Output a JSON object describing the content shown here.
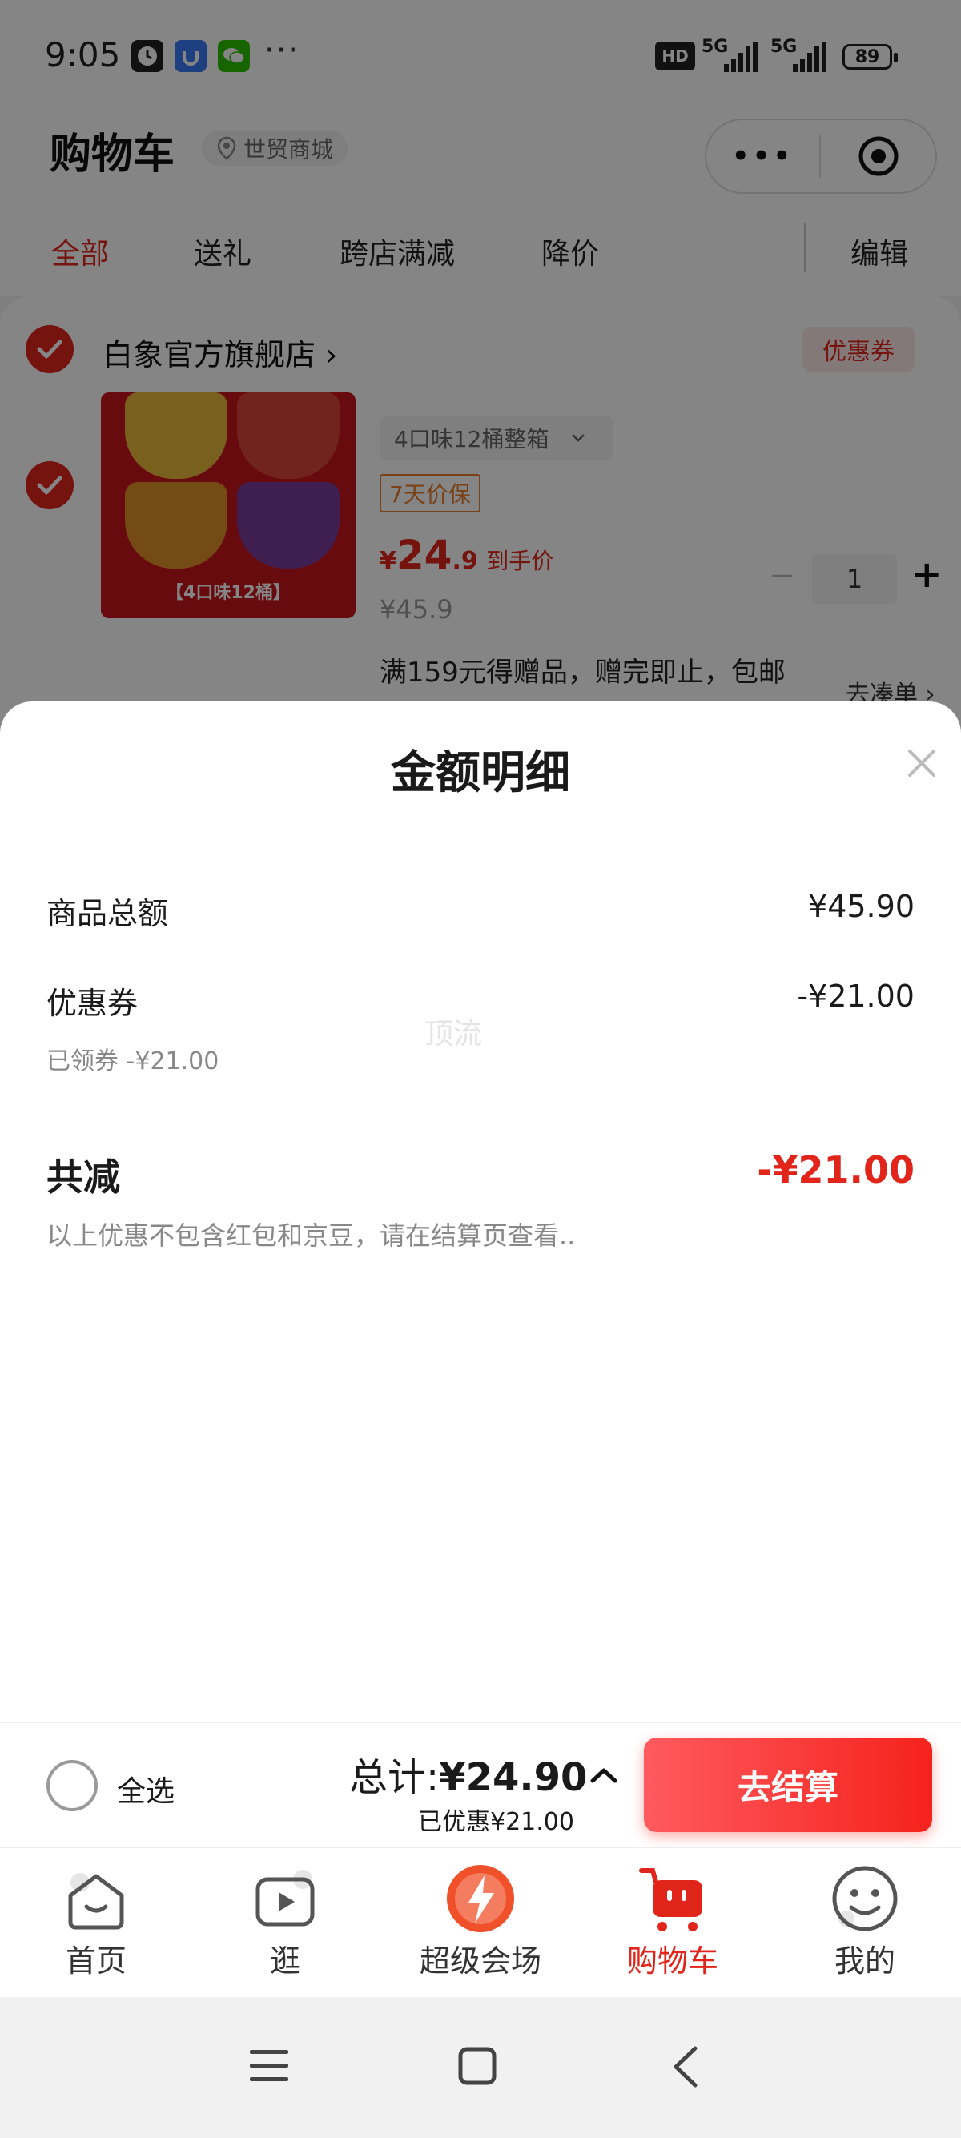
{
  "status_bar": {
    "time": "9:05",
    "dots": "···",
    "signal_1": "5G",
    "signal_2": "5G",
    "hd_label": "HD",
    "battery": "89"
  },
  "header": {
    "title": "购物车",
    "location": "世贸商城",
    "tabs": [
      {
        "label": "全部",
        "active": true
      },
      {
        "label": "送礼"
      },
      {
        "label": "跨店满减"
      },
      {
        "label": "降价"
      }
    ],
    "edit_label": "编辑"
  },
  "cart": {
    "store_name": "白象官方旗舰店",
    "store_arrow": "›",
    "coupon_label": "优惠券",
    "product": {
      "image_label": "【4口味12桶】",
      "variant": "4口味12桶整箱",
      "guarantee": "7天价保",
      "currency": "¥",
      "price_int": "24",
      "price_dec": ".9",
      "price_note": "到手价",
      "original_price": "¥45.9",
      "quantity": "1",
      "minus": "−",
      "plus": "+",
      "promo": "满159元得赠品，赠完即止，包邮",
      "promo_link": "去凑单 ›"
    }
  },
  "sheet": {
    "title": "金额明细",
    "rows": [
      {
        "label": "商品总额",
        "value": "¥45.90"
      },
      {
        "label": "优惠券",
        "value": "-¥21.00",
        "sub": "已领券 -¥21.00"
      }
    ],
    "watermark": "顶流",
    "total_label": "共减",
    "total_value": "-¥21.00",
    "note": "以上优惠不包含红包和京豆，请在结算页查看.."
  },
  "checkout": {
    "select_all": "全选",
    "total_prefix": "总计:",
    "total_amount": "¥24.90",
    "saved": "已优惠¥21.00",
    "pay_button": "去结算"
  },
  "tabbar": {
    "items": [
      {
        "label": "首页",
        "icon": "home-icon"
      },
      {
        "label": "逛",
        "icon": "play-icon"
      },
      {
        "label": "超级会场",
        "icon": "super-venue-icon"
      },
      {
        "label": "购物车",
        "icon": "cart-icon",
        "active": true
      },
      {
        "label": "我的",
        "icon": "profile-icon"
      }
    ]
  },
  "colors": {
    "accent": "#e1251b",
    "pay_button": "#f5221c",
    "overlay": "rgba(0,0,0,0.48)"
  }
}
